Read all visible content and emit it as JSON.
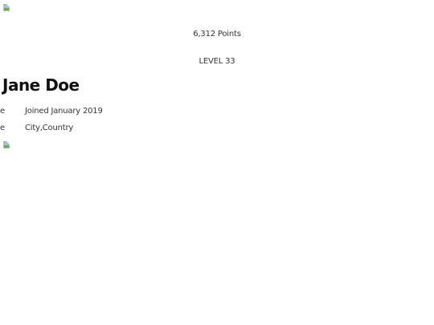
{
  "profile": {
    "points": "6,312 Points",
    "level": "LEVEL 33",
    "name": "Jane Doe",
    "info_rows": [
      {
        "label_fragment": "e",
        "value": "Joined January 2019",
        "icon": "calendar-icon"
      },
      {
        "label_fragment": "le",
        "value": "City,Country",
        "icon": "location-icon"
      }
    ]
  },
  "images": {
    "top": "broken-image-icon",
    "bottom": "broken-image-icon"
  }
}
